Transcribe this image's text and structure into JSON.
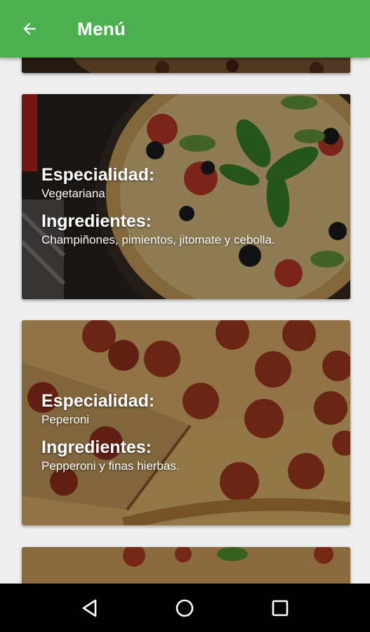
{
  "appbar": {
    "title": "Menú",
    "back_icon": "arrow-back-icon",
    "color": "#4caf50"
  },
  "cards": [
    {
      "specialty_label": "Especialidad:",
      "specialty": "Vegetariana",
      "ingredients_label": "Ingredientes:",
      "ingredients": "Champiñones, pimientos, jitomate y cebolla."
    },
    {
      "specialty_label": "Especialidad:",
      "specialty": "Peperoni",
      "ingredients_label": "Ingredientes:",
      "ingredients": "Pepperoni y finas hierbas."
    }
  ],
  "navbar": {
    "back_icon": "triangle-back-icon",
    "home_icon": "circle-home-icon",
    "recents_icon": "square-recents-icon"
  }
}
